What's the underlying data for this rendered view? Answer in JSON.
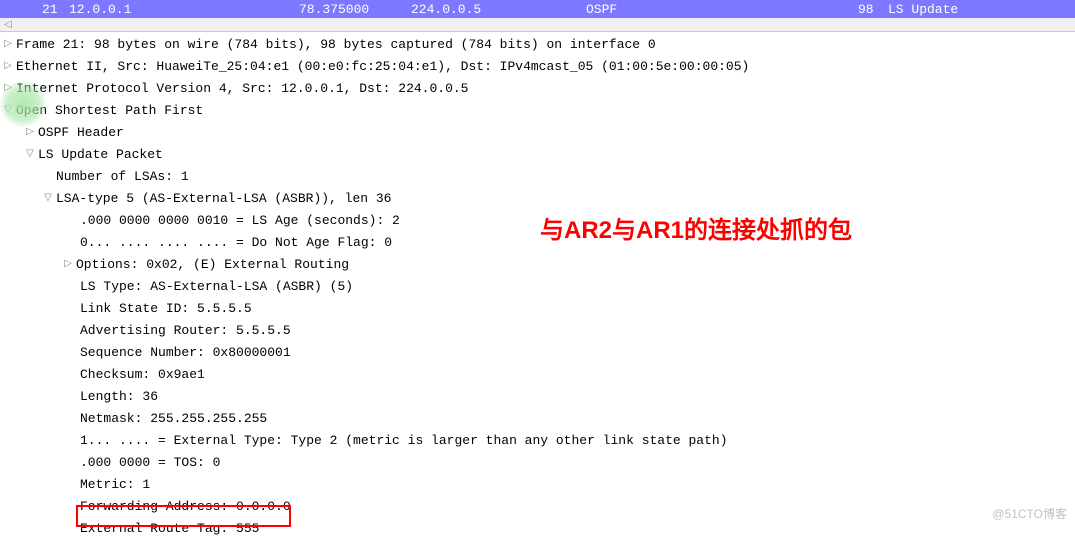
{
  "packet_row": {
    "no": "21",
    "source": "12.0.0.1",
    "time": "78.375000",
    "destination": "224.0.0.5",
    "protocol": "OSPF",
    "length": "98",
    "info": "LS Update"
  },
  "details": {
    "frame": "Frame 21: 98 bytes on wire (784 bits), 98 bytes captured (784 bits) on interface 0",
    "ethernet": "Ethernet II, Src: HuaweiTe_25:04:e1 (00:e0:fc:25:04:e1), Dst: IPv4mcast_05 (01:00:5e:00:00:05)",
    "ip": "Internet Protocol Version 4, Src: 12.0.0.1, Dst: 224.0.0.5",
    "ospf": "Open Shortest Path First",
    "ospf_header": "OSPF Header",
    "ls_update": "LS Update Packet",
    "num_lsas": "Number of LSAs: 1",
    "lsa_type": "LSA-type 5 (AS-External-LSA (ASBR)), len 36",
    "ls_age": ".000 0000 0000 0010 = LS Age (seconds): 2",
    "dna_flag": "0... .... .... .... = Do Not Age Flag: 0",
    "options": "Options: 0x02, (E) External Routing",
    "ls_type_field": "LS Type: AS-External-LSA (ASBR) (5)",
    "link_state_id": "Link State ID: 5.5.5.5",
    "adv_router": "Advertising Router: 5.5.5.5",
    "seq_num": "Sequence Number: 0x80000001",
    "checksum": "Checksum: 0x9ae1",
    "length": "Length: 36",
    "netmask": "Netmask: 255.255.255.255",
    "ext_type": "1... .... = External Type: Type 2 (metric is larger than any other link state path)",
    "tos": ".000 0000 = TOS: 0",
    "metric": "Metric: 1",
    "fwd_addr": "Forwarding Address: 0.0.0.0",
    "ext_tag": "External Route Tag: 555"
  },
  "annotation": "与AR2与AR1的连接处抓的包",
  "watermark": "@51CTO博客"
}
